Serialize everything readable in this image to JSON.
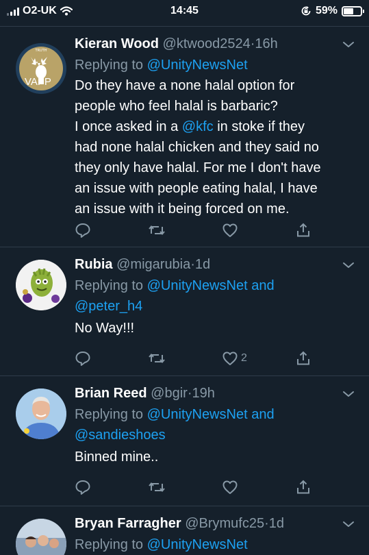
{
  "status_bar": {
    "carrier": "O2-UK",
    "time": "14:45",
    "battery_percent": "59%",
    "battery_level": 0.59
  },
  "tweets": [
    {
      "name": "Kieran Wood",
      "handle": "@ktwood2524",
      "age": "16h",
      "avatar_text": "VAPP",
      "avatar_small_text": "TRUTH",
      "replying_prefix": "Replying to",
      "replying_to": [
        "@UnityNewsNet"
      ],
      "body_lines": [
        {
          "text": "Do they have a none halal option for"
        },
        {
          "text": "people who feel halal is barbaric?"
        },
        {
          "before": "I once asked in a ",
          "mention": "@kfc",
          "after": " in stoke if they"
        },
        {
          "text": "had none halal chicken and they said no"
        },
        {
          "text": "they only have halal. For me I don't have"
        },
        {
          "text": "an issue with people eating halal, I have"
        },
        {
          "text": "an issue with it being forced on me."
        }
      ],
      "like_count": ""
    },
    {
      "name": "Rubia",
      "handle": "@migarubia",
      "age": "1d",
      "replying_prefix": "Replying to",
      "replying_to": [
        "@UnityNewsNet",
        "@peter_h4"
      ],
      "replying_joiner": "and",
      "body_lines": [
        {
          "text": "No Way!!!"
        }
      ],
      "like_count": "2"
    },
    {
      "name": "Brian Reed",
      "handle": "@bgir",
      "age": "19h",
      "replying_prefix": "Replying to",
      "replying_to": [
        "@UnityNewsNet",
        "@sandieshoes"
      ],
      "replying_joiner": "and",
      "body_lines": [
        {
          "text": "Binned mine.."
        }
      ],
      "like_count": ""
    },
    {
      "name": "Bryan Farragher",
      "handle": "@Brymufc25",
      "age": "1d",
      "replying_prefix": "Replying to",
      "replying_to": [
        "@UnityNewsNet"
      ]
    }
  ],
  "colors": {
    "background": "#15202b",
    "link": "#1da1f2",
    "secondary_text": "#8899a6",
    "divider": "#2f3c4a"
  },
  "icons": [
    "signal-icon",
    "wifi-icon",
    "orientation-lock-icon",
    "battery-icon",
    "chevron-down-icon",
    "reply-icon",
    "retweet-icon",
    "like-icon",
    "share-icon"
  ]
}
